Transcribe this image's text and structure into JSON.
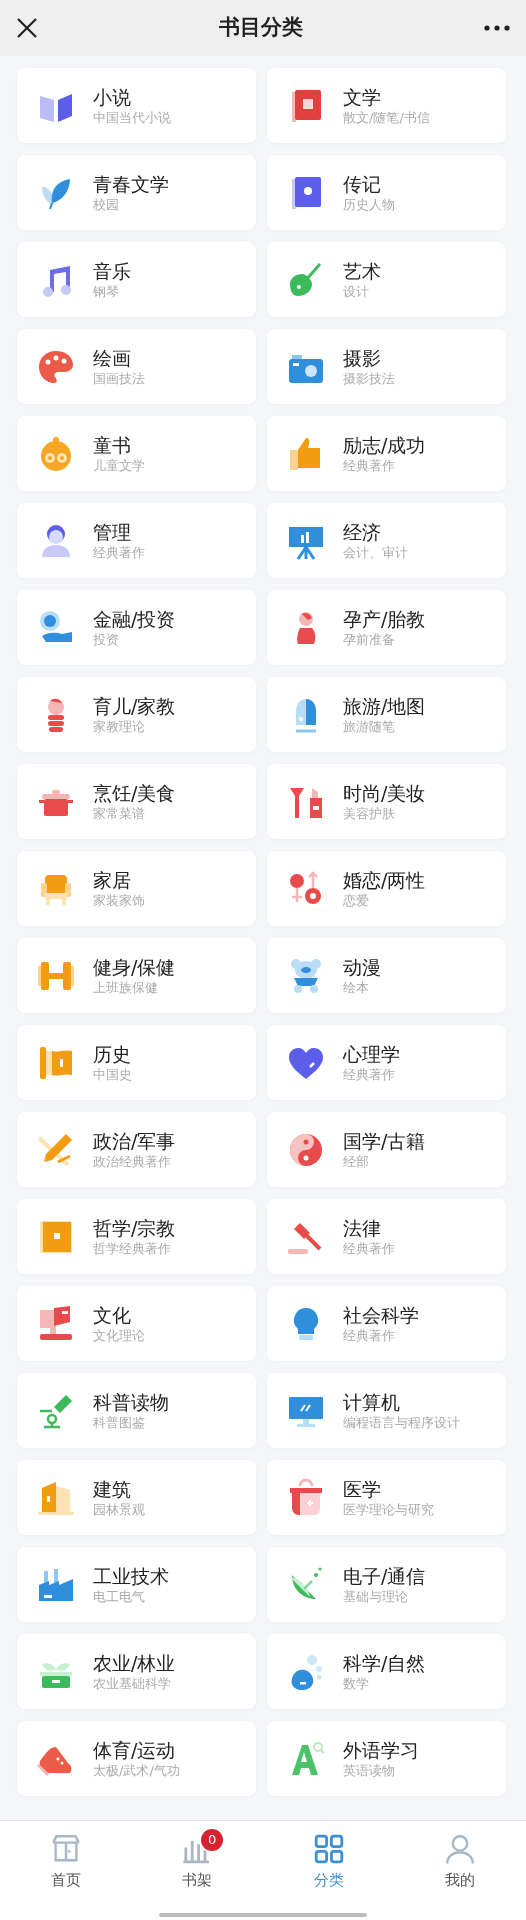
{
  "header": {
    "title": "书目分类"
  },
  "categories": [
    {
      "title": "小说",
      "subtitle": "中国当代小说"
    },
    {
      "title": "文学",
      "subtitle": "散文/随笔/书信"
    },
    {
      "title": "青春文学",
      "subtitle": "校园"
    },
    {
      "title": "传记",
      "subtitle": "历史人物"
    },
    {
      "title": "音乐",
      "subtitle": "钢琴"
    },
    {
      "title": "艺术",
      "subtitle": "设计"
    },
    {
      "title": "绘画",
      "subtitle": "国画技法"
    },
    {
      "title": "摄影",
      "subtitle": "摄影技法"
    },
    {
      "title": "童书",
      "subtitle": "儿童文学"
    },
    {
      "title": "励志/成功",
      "subtitle": "经典著作"
    },
    {
      "title": "管理",
      "subtitle": "经典著作"
    },
    {
      "title": "经济",
      "subtitle": "会计、审计"
    },
    {
      "title": "金融/投资",
      "subtitle": "投资"
    },
    {
      "title": "孕产/胎教",
      "subtitle": "孕前准备"
    },
    {
      "title": "育儿/家教",
      "subtitle": "家教理论"
    },
    {
      "title": "旅游/地图",
      "subtitle": "旅游随笔"
    },
    {
      "title": "烹饪/美食",
      "subtitle": "家常菜谱"
    },
    {
      "title": "时尚/美妆",
      "subtitle": "美容护肤"
    },
    {
      "title": "家居",
      "subtitle": "家装家饰"
    },
    {
      "title": "婚恋/两性",
      "subtitle": "恋爱"
    },
    {
      "title": "健身/保健",
      "subtitle": "上班族保健"
    },
    {
      "title": "动漫",
      "subtitle": "绘本"
    },
    {
      "title": "历史",
      "subtitle": "中国史"
    },
    {
      "title": "心理学",
      "subtitle": "经典著作"
    },
    {
      "title": "政治/军事",
      "subtitle": "政治经典著作"
    },
    {
      "title": "国学/古籍",
      "subtitle": "经部"
    },
    {
      "title": "哲学/宗教",
      "subtitle": "哲学经典著作"
    },
    {
      "title": "法律",
      "subtitle": "经典著作"
    },
    {
      "title": "文化",
      "subtitle": "文化理论"
    },
    {
      "title": "社会科学",
      "subtitle": "经典著作"
    },
    {
      "title": "科普读物",
      "subtitle": "科普图鉴"
    },
    {
      "title": "计算机",
      "subtitle": "编程语言与程序设计"
    },
    {
      "title": "建筑",
      "subtitle": "园林景观"
    },
    {
      "title": "医学",
      "subtitle": "医学理论与研究"
    },
    {
      "title": "工业技术",
      "subtitle": "电工电气"
    },
    {
      "title": "电子/通信",
      "subtitle": "基础与理论"
    },
    {
      "title": "农业/林业",
      "subtitle": "农业基础科学"
    },
    {
      "title": "科学/自然",
      "subtitle": "数学"
    },
    {
      "title": "体育/运动",
      "subtitle": "太极/武术/气功"
    },
    {
      "title": "外语学习",
      "subtitle": "英语读物"
    }
  ],
  "tab_bar": [
    {
      "label": "首页",
      "selected": false
    },
    {
      "label": "书架",
      "selected": false,
      "badge": "0"
    },
    {
      "label": "分类",
      "selected": true
    },
    {
      "label": "我的",
      "selected": false
    }
  ]
}
